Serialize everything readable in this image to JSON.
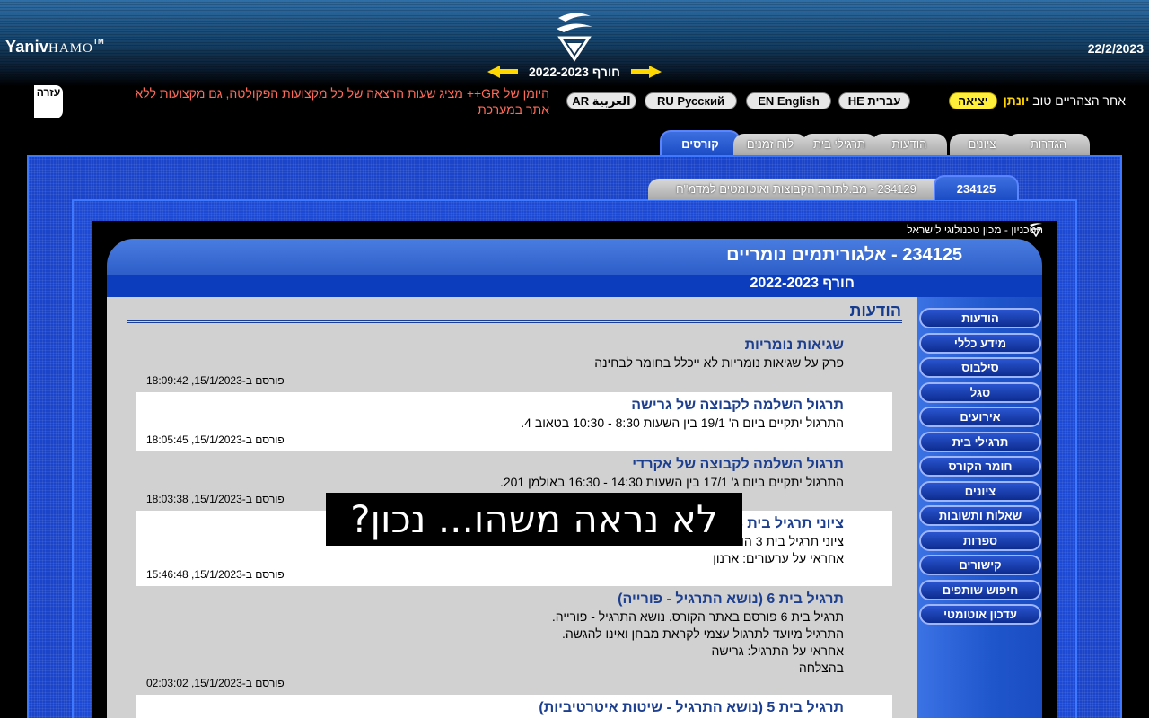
{
  "header": {
    "brand_main": "Yaniv",
    "brand_small": "HAMO",
    "brand_tm": "TM",
    "date": "22/2/2023",
    "semester": "חורף 2022-2023"
  },
  "infobar": {
    "greeting_prefix": "אחר הצהריים טוב ",
    "user_name": "יונתן",
    "logout": "יציאה",
    "languages": [
      "HE עברית",
      "EN English",
      "RU Русский",
      "AR العربية"
    ],
    "notice": "היומן של GR++ מציג שעות הרצאה של כל מקצועות הפקולטה, גם מקצועות ללא אתר במערכת",
    "help": "עזרה"
  },
  "main_tabs": [
    "קורסים",
    "לוח זמנים",
    "תרגילי בית",
    "הודעות",
    "ציונים",
    "הגדרות"
  ],
  "course_tabs": {
    "active": "234125",
    "other": "234129 - מב.לתורת הקבוצות ואוטומטים למדמ\"ח"
  },
  "institution": "הטכניון - מכון טכנולוגי לישראל",
  "course": {
    "title": "234125 - אלגוריתמים נומריים",
    "semester": "חורף 2022-2023",
    "section": "הודעות"
  },
  "announcements": [
    {
      "title": "שגיאות נומריות",
      "lines": [
        "פרק על שגיאות נומריות לא ייכלל בחומר לבחינה"
      ],
      "posted": "פורסם ב-15/1/2023, 18:09:42"
    },
    {
      "title": "תרגול השלמה לקבוצה של גרישה",
      "lines": [
        "התרגול יתקיים ביום ה' 19/1 בין השעות 8:30 - 10:30 בטאוב 4."
      ],
      "posted": "פורסם ב-15/1/2023, 18:05:45"
    },
    {
      "title": "תרגול השלמה לקבוצה של אקרדי",
      "lines": [
        "התרגול יתקיים ביום ג' 17/1 בין השעות 14:30 - 16:30 באולמן 201."
      ],
      "posted": "פורסם ב-15/1/2023, 18:03:38"
    },
    {
      "title": "ציוני תרגיל בית 3",
      "lines": [
        "ציוני תרגיל בית 3 הו",
        "אחראי על ערעורים: ארנון"
      ],
      "posted": "פורסם ב-15/1/2023, 15:46:48"
    },
    {
      "title": "תרגיל בית 6 (נושא התרגיל - פורייה)",
      "lines": [
        "תרגיל בית 6 פורסם באתר הקורס. נושא התרגיל - פורייה.",
        "התרגיל מיועד לתרגול עצמי לקראת מבחן ואינו להגשה.",
        "אחראי על התרגיל: גרישה",
        "בהצלחה"
      ],
      "posted": "פורסם ב-15/1/2023, 02:03:02"
    },
    {
      "title": "תרגיל בית 5 (נושא התרגיל - שיטות איטרטיביות)",
      "lines": [],
      "posted": ""
    }
  ],
  "sidebar": [
    "הודעות",
    "מידע כללי",
    "סילבוס",
    "סגל",
    "אירועים",
    "תרגילי בית",
    "חומר הקורס",
    "ציונים",
    "שאלות ותשובות",
    "ספרות",
    "קישורים",
    "חיפוש שותפים",
    "עדכון אוטומטי"
  ],
  "overlay": "לא נראה משהו... נכון?"
}
